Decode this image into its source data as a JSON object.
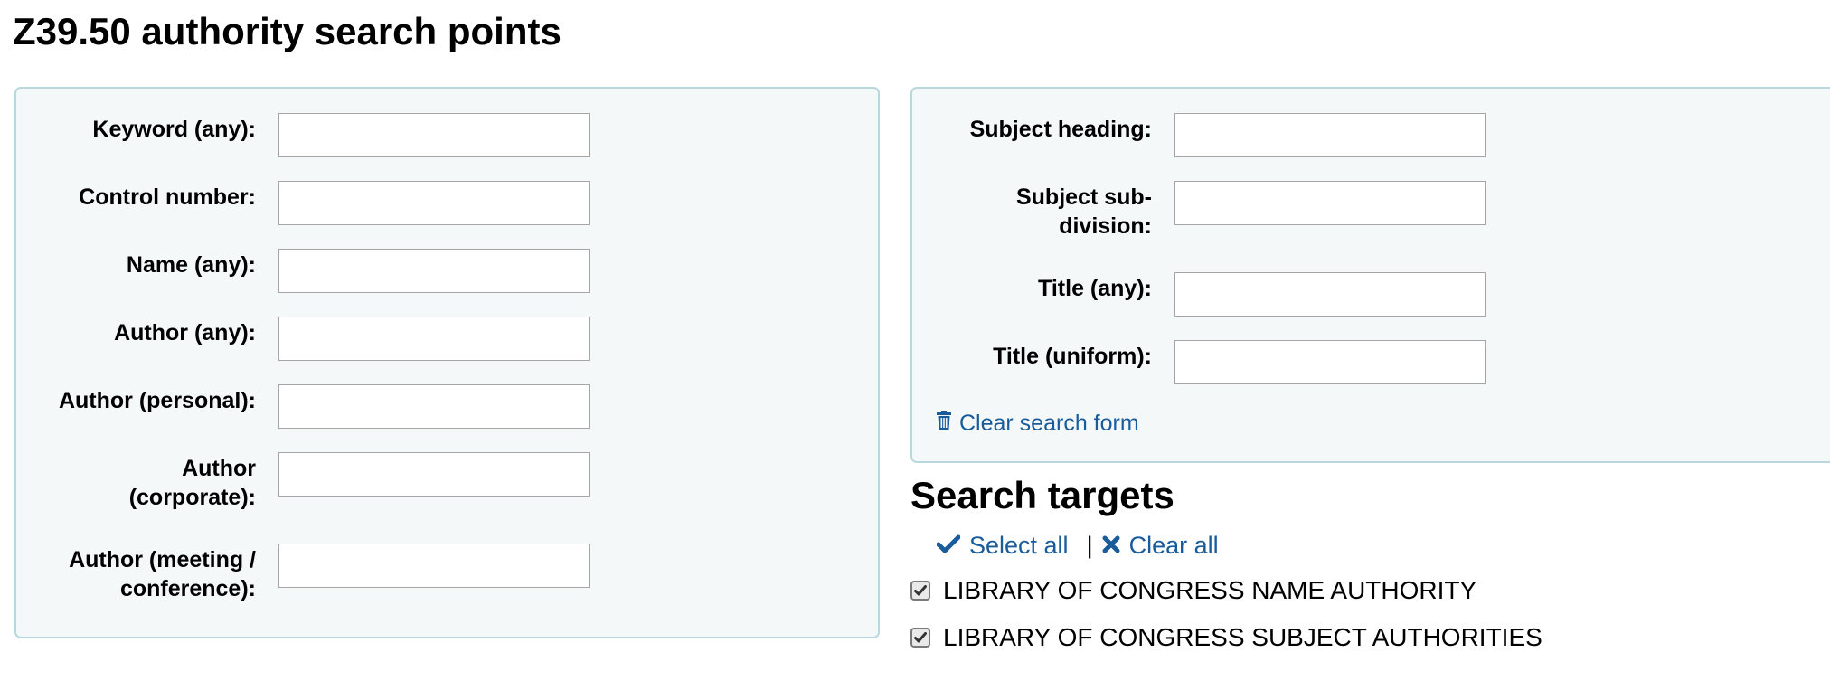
{
  "page_title": "Z39.50 authority search points",
  "left_fields": [
    {
      "label": "Keyword (any):",
      "value": ""
    },
    {
      "label": "Control number:",
      "value": ""
    },
    {
      "label": "Name (any):",
      "value": ""
    },
    {
      "label": "Author (any):",
      "value": ""
    },
    {
      "label": "Author (personal):",
      "value": ""
    },
    {
      "label": "Author (corporate):",
      "value": ""
    },
    {
      "label": "Author (meeting / conference):",
      "value": ""
    }
  ],
  "right_fields": [
    {
      "label": "Subject heading:",
      "value": ""
    },
    {
      "label": "Subject sub-division:",
      "value": ""
    },
    {
      "label": "Title (any):",
      "value": ""
    },
    {
      "label": "Title (uniform):",
      "value": ""
    }
  ],
  "clear_search_form": "Clear search form",
  "targets": {
    "title": "Search targets",
    "select_all": "Select all",
    "separator": "|",
    "clear_all": "Clear all",
    "items": [
      {
        "label": "LIBRARY OF CONGRESS NAME AUTHORITY",
        "checked": true
      },
      {
        "label": "LIBRARY OF CONGRESS SUBJECT AUTHORITIES",
        "checked": true
      }
    ]
  },
  "colors": {
    "link": "#1a5b9a",
    "panel_bg": "#f4f8f9",
    "panel_border": "#b9d8dd"
  },
  "icons": [
    "trash-icon",
    "check-icon",
    "times-icon",
    "checkbox-checked-icon"
  ]
}
